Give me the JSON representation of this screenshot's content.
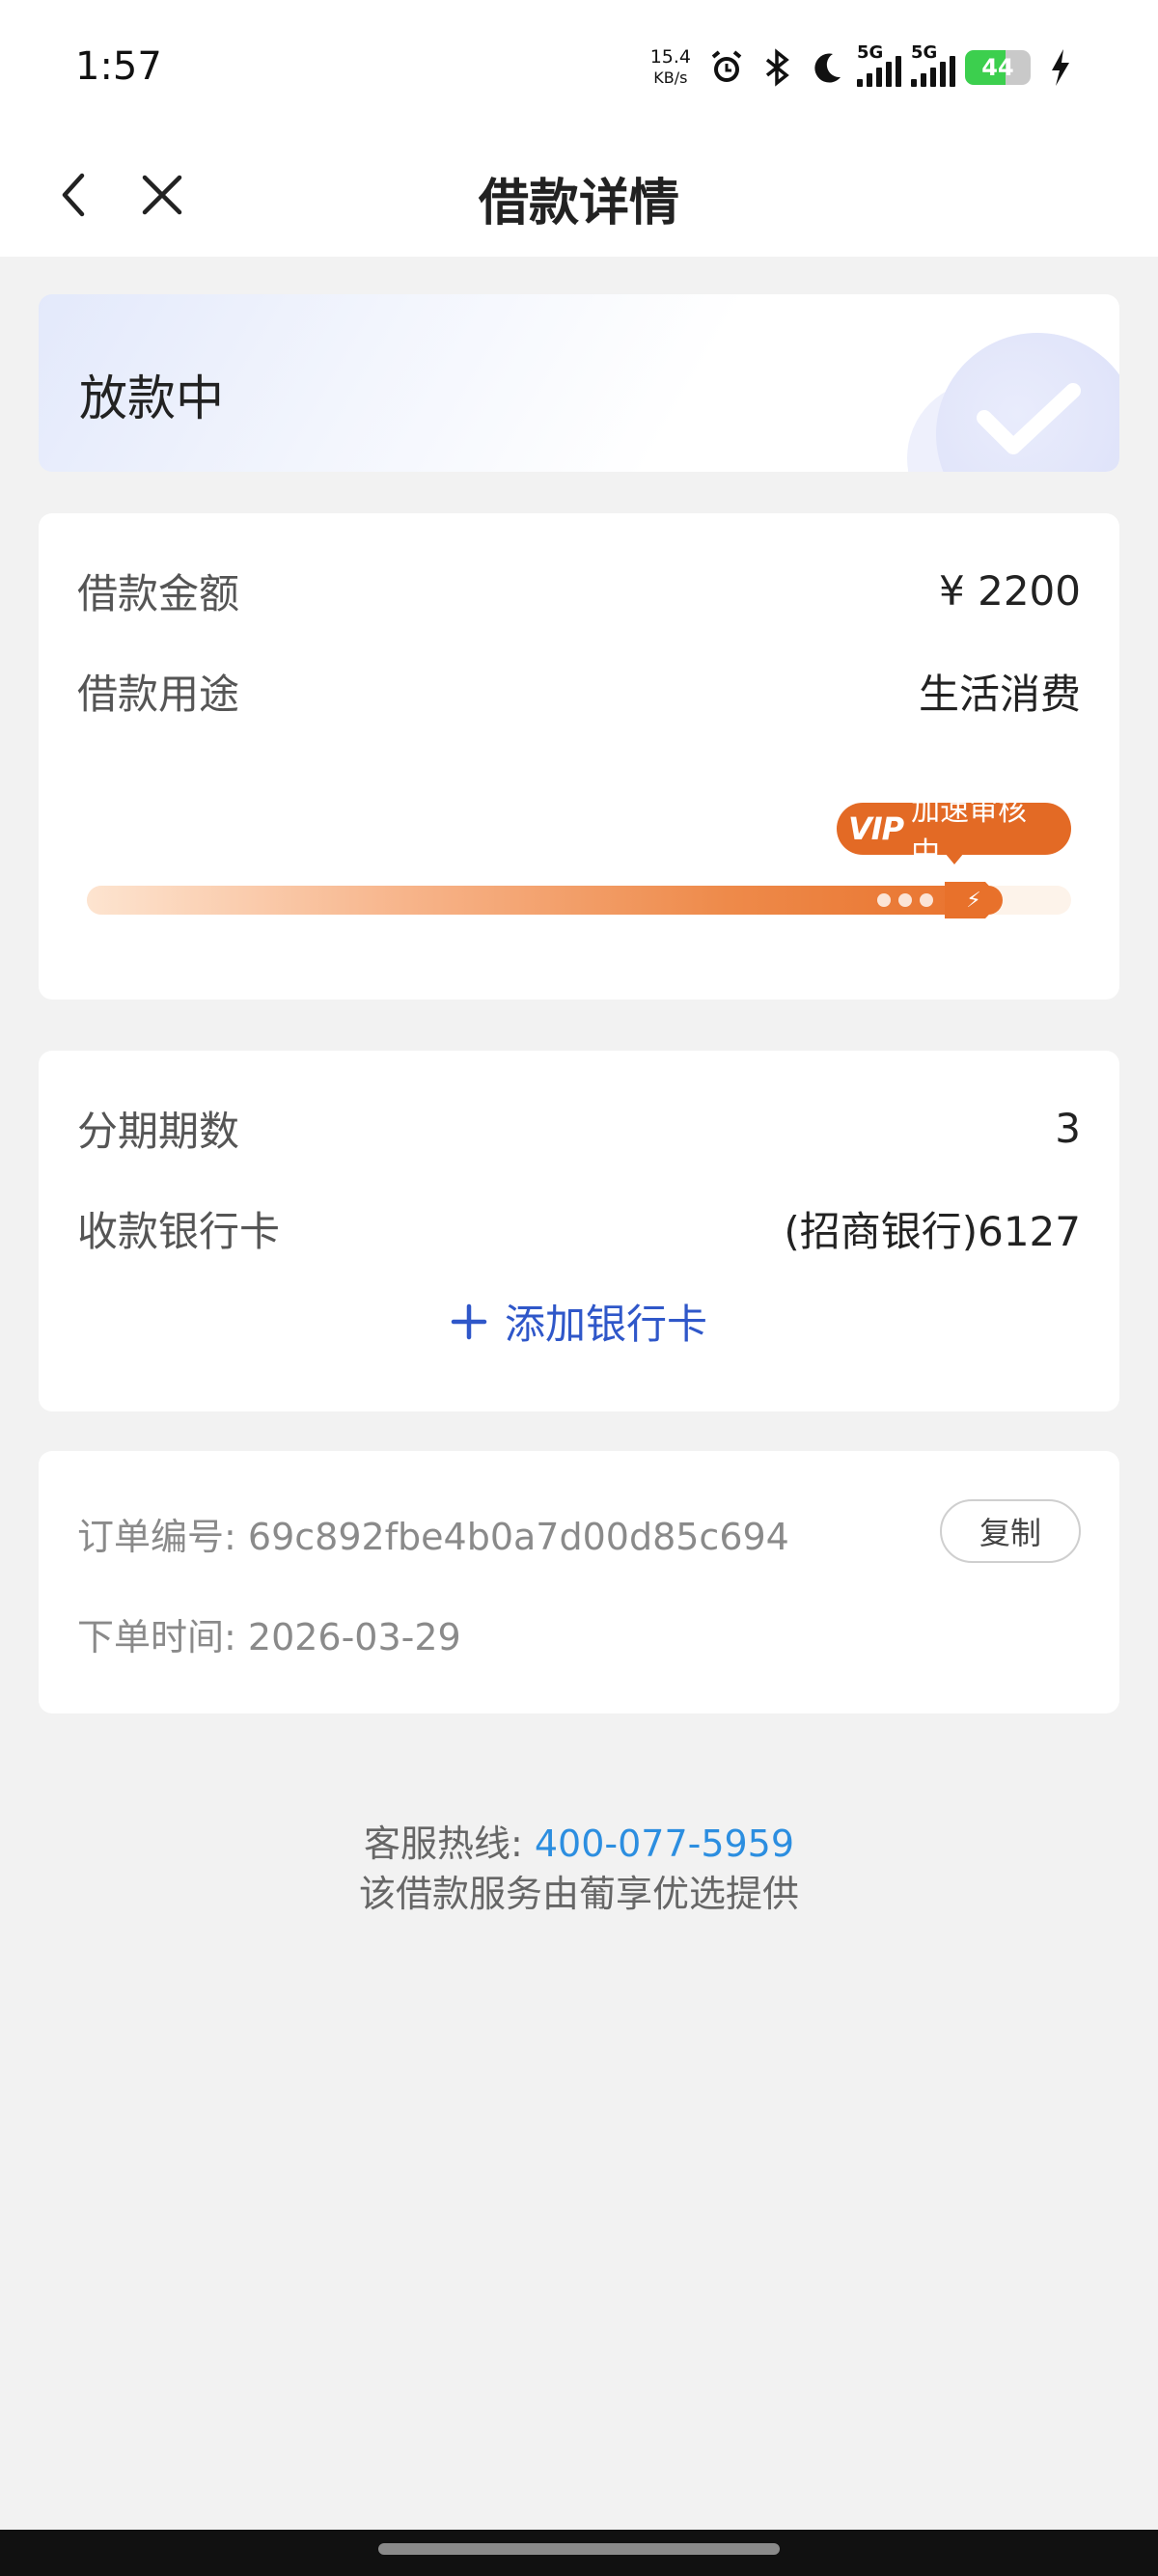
{
  "status_bar": {
    "time": "1:57",
    "net_speed_value": "15.4",
    "net_speed_unit": "KB/s",
    "signal1_label": "5G",
    "signal2_label": "5G",
    "battery": "44",
    "icons": [
      "alarm-icon",
      "bluetooth-icon",
      "moon-icon",
      "signal-icon",
      "battery-icon",
      "charging-icon"
    ]
  },
  "nav": {
    "title": "借款详情",
    "back_icon": "chevron-left-icon",
    "close_icon": "close-icon"
  },
  "status_card": {
    "text": "放款中",
    "icon": "check-icon"
  },
  "loan_card": {
    "amount_label": "借款金额",
    "amount_value": "¥ 2200",
    "purpose_label": "借款用途",
    "purpose_value": "生活消费",
    "badge_vip": "VIP",
    "badge_text": "加速审核中",
    "progress": 0.93
  },
  "install_card": {
    "periods_label": "分期期数",
    "periods_value": "3",
    "bank_label": "收款银行卡",
    "bank_value": "(招商银行)6127",
    "add_card_label": "添加银行卡"
  },
  "order_card": {
    "order_no_label": "订单编号: ",
    "order_no": "69c892fbe4b0a7d00d85c694",
    "copy_label": "复制",
    "time_label": "下单时间: ",
    "time_value": "2026-03-29"
  },
  "footer": {
    "hotline_label": "客服热线: ",
    "hotline_number": "400-077-5959",
    "provider": "该借款服务由葡享优选提供"
  },
  "colors": {
    "accent_orange": "#e8712b",
    "link_blue": "#2f57c9",
    "phone_blue": "#2c8ee0"
  }
}
